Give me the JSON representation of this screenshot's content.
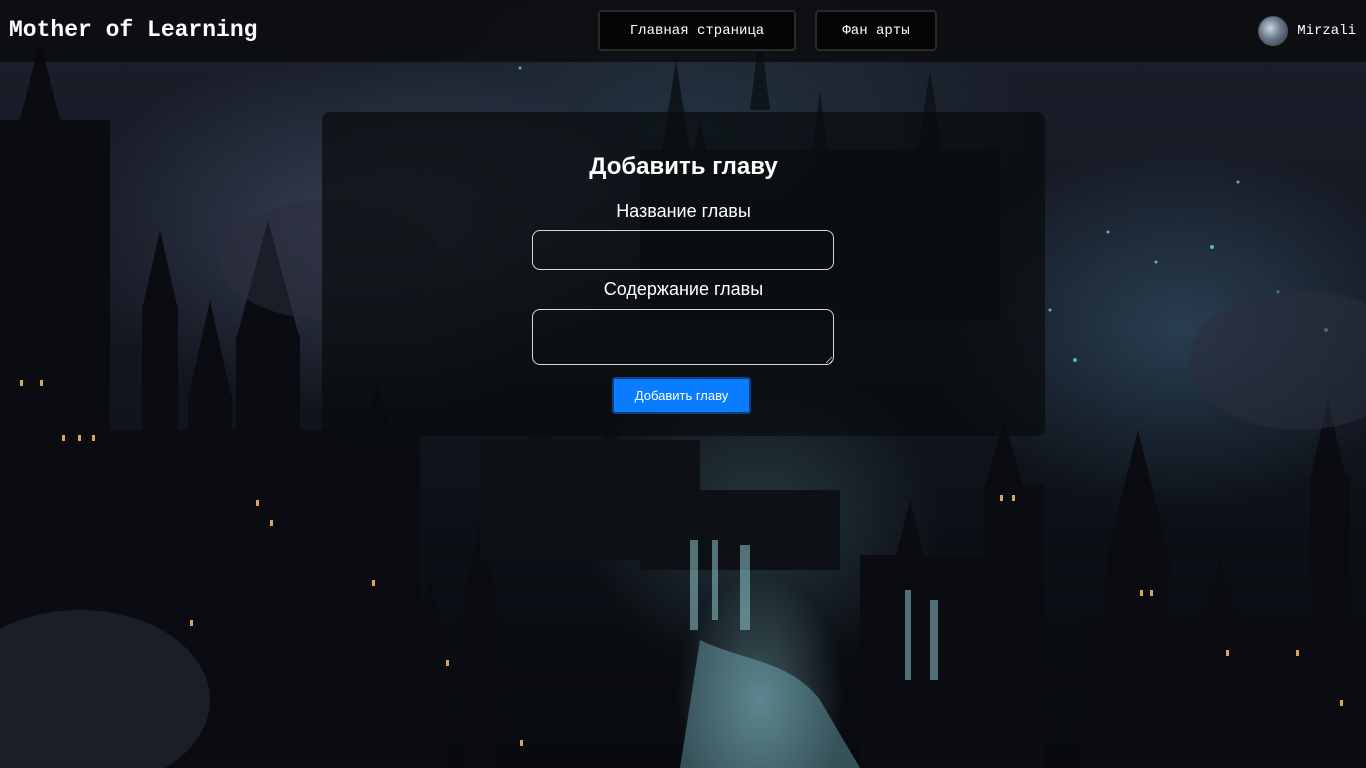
{
  "navbar": {
    "brand": "Mother of Learning",
    "links": [
      {
        "label": "Главная страница"
      },
      {
        "label": "Фан арты"
      }
    ],
    "user": {
      "name": "Mirzali"
    }
  },
  "form": {
    "title": "Добавить главу",
    "chapter_title_label": "Название главы",
    "chapter_title_value": "",
    "chapter_content_label": "Содержание главы",
    "chapter_content_value": "",
    "submit_label": "Добавить главу"
  },
  "colors": {
    "accent": "#0a7cff",
    "navbar_bg": "#0a0a0c",
    "text": "#ffffff"
  }
}
